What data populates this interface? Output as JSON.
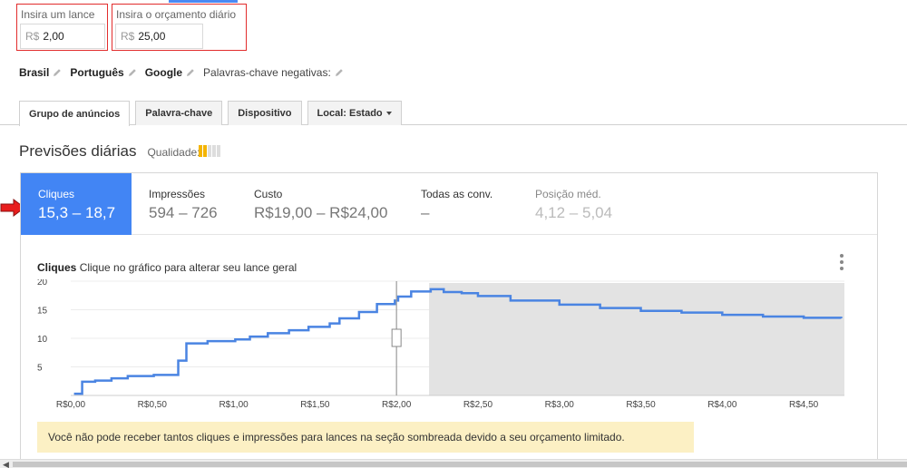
{
  "bid": {
    "label": "Insira um lance",
    "currency": "R$",
    "value": "2,00"
  },
  "budget": {
    "label": "Insira o orçamento diário",
    "currency": "R$",
    "value": "25,00"
  },
  "settings": [
    {
      "label": "Brasil",
      "bold": true
    },
    {
      "label": "Português",
      "bold": true
    },
    {
      "label": "Google",
      "bold": true
    },
    {
      "label": "Palavras-chave negativas:",
      "bold": false
    }
  ],
  "tabs": [
    {
      "label": "Grupo de anúncios",
      "active": true
    },
    {
      "label": "Palavra-chave",
      "active": false
    },
    {
      "label": "Dispositivo",
      "active": false
    },
    {
      "label": "Local: Estado",
      "active": false,
      "dropdown": true
    }
  ],
  "forecast": {
    "title": "Previsões diárias",
    "quality_label": "Qualidade:",
    "quality_level": 2,
    "quality_max": 5
  },
  "metrics": [
    {
      "label": "Cliques",
      "value": "15,3 – 18,7",
      "state": "active"
    },
    {
      "label": "Impressões",
      "value": "594 – 726",
      "state": "normal"
    },
    {
      "label": "Custo",
      "value": "R$19,00 – R$24,00",
      "state": "normal"
    },
    {
      "label": "Todas as conv.",
      "value": "–",
      "state": "normal"
    },
    {
      "label": "Posição méd.",
      "value": "4,12 – 5,04",
      "state": "dim"
    }
  ],
  "chart_title": {
    "metric": "Cliques",
    "hint": "Clique no gráfico para alterar seu lance geral"
  },
  "chart_data": {
    "type": "line",
    "xlabel": "",
    "ylabel": "",
    "x_ticks": [
      "R$0,00",
      "R$0,50",
      "R$1,00",
      "R$1,50",
      "R$2,00",
      "R$2,50",
      "R$3,00",
      "R$3,50",
      "R$4,00",
      "R$4,50"
    ],
    "y_ticks": [
      5,
      10,
      15,
      20
    ],
    "xlim": [
      0,
      4.75
    ],
    "ylim": [
      0,
      20
    ],
    "selected_bid": 2.0,
    "shaded_from": 2.2,
    "series": [
      {
        "step": true,
        "x": [
          0.02,
          0.07,
          0.15,
          0.25,
          0.35,
          0.51,
          0.66,
          0.71,
          0.84,
          1.01,
          1.1,
          1.21,
          1.34,
          1.46,
          1.59,
          1.65,
          1.77,
          1.88,
          1.99,
          2.01,
          2.09,
          2.21,
          2.29,
          2.4,
          2.5,
          2.7,
          3.0,
          3.25,
          3.5,
          3.75,
          4.0,
          4.25,
          4.5,
          4.73
        ],
        "y": [
          0.3,
          2.4,
          2.6,
          3.0,
          3.4,
          3.6,
          6.1,
          9.1,
          9.5,
          9.8,
          10.3,
          10.9,
          11.4,
          12.0,
          12.6,
          13.5,
          14.6,
          16.0,
          16.6,
          17.3,
          18.2,
          18.6,
          18.1,
          17.9,
          17.4,
          16.6,
          15.9,
          15.3,
          14.8,
          14.5,
          14.1,
          13.8,
          13.6,
          13.5
        ]
      }
    ]
  },
  "notice": "Você não pode receber tantos cliques e impressões para lances na seção sombreada devido a seu orçamento limitado."
}
